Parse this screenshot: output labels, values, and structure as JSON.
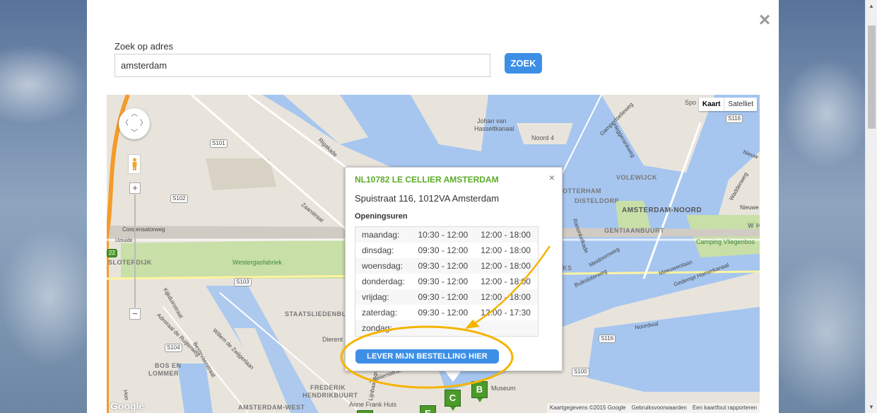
{
  "modal": {
    "close_icon": "×",
    "search_label": "Zoek op adres",
    "search_value": "amsterdam",
    "search_button": "ZOEK"
  },
  "map": {
    "map_type": {
      "map": "Kaart",
      "satellite": "Satelliet"
    },
    "zoom_in": "+",
    "zoom_out": "−",
    "google": "Google",
    "attribution": {
      "data": "Kaartgegevens ©2015 Google",
      "terms": "Gebruiksvoorwaarden",
      "report": "Een kaartfout rapporteren"
    },
    "labels": {
      "johan": "Johan van",
      "hasselt": "Hasseltkanaal",
      "noord4": "Noord 4",
      "volewijck": "VOLEWIJCK",
      "disteldorp": "DISTELDORP",
      "amsterdam_noord": "AMSTERDAM-NOORD",
      "gentiaanbuurt": "GENTIAANBUURT",
      "camping": "Camping Vliegenbos",
      "westergasfabriek": "Westergasfabriek",
      "sloterdijk": "SLOTERDIJK",
      "staatsliedenbuurt": "STAATSLIEDENBU",
      "frederik": "FREDERIK",
      "hendrikbuurt": "HENDRIKBUURT",
      "bos_en": "BOS EN",
      "lommer": "LOMMER",
      "amsterdam_west": "AMSTERDAM-WEST",
      "anne_frank": "Anne Frank Huis",
      "condensatorweg": "Condensatorweg",
      "rigakade": "Rigakade",
      "zaanstraat": "Zaanstraat",
      "kijkduinstraat": "Kijkduinstraat",
      "admiraal": "Admiraal de Ruijterweg",
      "bestevaerstraat": "Bestevaerstraat",
      "willem": "Willem de Zwijgerlaan",
      "meeuwenlaan": "Meeuwenlaan",
      "gedempt": "Gedempt Hamerkanaal",
      "noordwal": "Noordwal",
      "buiksloterweg": "Buiksloterweg",
      "meidoornweg": "Meidoornweg",
      "ranonkelkade": "Ranonkelkade",
      "waddenweg": "Waddenweg",
      "nieuwe": "Nieuwe",
      "ijmuiden": "IJmuide",
      "gamper": "Gamperfoelieweg",
      "heggerank": "Heggerankweg",
      "otterham": "OTTERHAM",
      "ks": "KS",
      "dierent": "Dierent",
      "wh": "W H",
      "nieuw": "Nieuw",
      "spo": "Spo",
      "anjeliers": "Anjeliersstraat",
      "lijnbaan": "Lijnbaansgracht",
      "museum": "Museum",
      "hoofdweg": "Hoo"
    },
    "shields": {
      "s101": "S101",
      "s102": "S102",
      "s103": "S103",
      "s104": "S104",
      "s116a": "S116",
      "s116b": "S116",
      "s100": "S100",
      "s22": "22"
    },
    "markers": [
      "B",
      "C",
      "E",
      "D"
    ]
  },
  "infowindow": {
    "close_icon": "×",
    "store_name": "NL10782 LE CELLIER AMSTERDAM",
    "address": "Spuistraat 116, 1012VA Amsterdam",
    "hours_title": "Openingsuren",
    "hours": [
      {
        "day": "maandag:",
        "h1": "10:30 - 12:00",
        "h2": "12:00 - 18:00"
      },
      {
        "day": "dinsdag:",
        "h1": "09:30 - 12:00",
        "h2": "12:00 - 18:00"
      },
      {
        "day": "woensdag:",
        "h1": "09:30 - 12:00",
        "h2": "12:00 - 18:00"
      },
      {
        "day": "donderdag:",
        "h1": "09:30 - 12:00",
        "h2": "12:00 - 18:00"
      },
      {
        "day": "vrijdag:",
        "h1": "09:30 - 12:00",
        "h2": "12:00 - 18:00"
      },
      {
        "day": "zaterdag:",
        "h1": "09:30 - 12:00",
        "h2": "12:00 - 17:30"
      },
      {
        "day": "zondag:",
        "h1": "",
        "h2": ""
      }
    ],
    "deliver_button": "LEVER MIJN BESTELLING HIER"
  },
  "colors": {
    "accent": "#3d8fe6",
    "store_name": "#5cab2a",
    "annotation": "#f5b400",
    "water": "#a6c6f0",
    "park": "#c8dfa8"
  }
}
